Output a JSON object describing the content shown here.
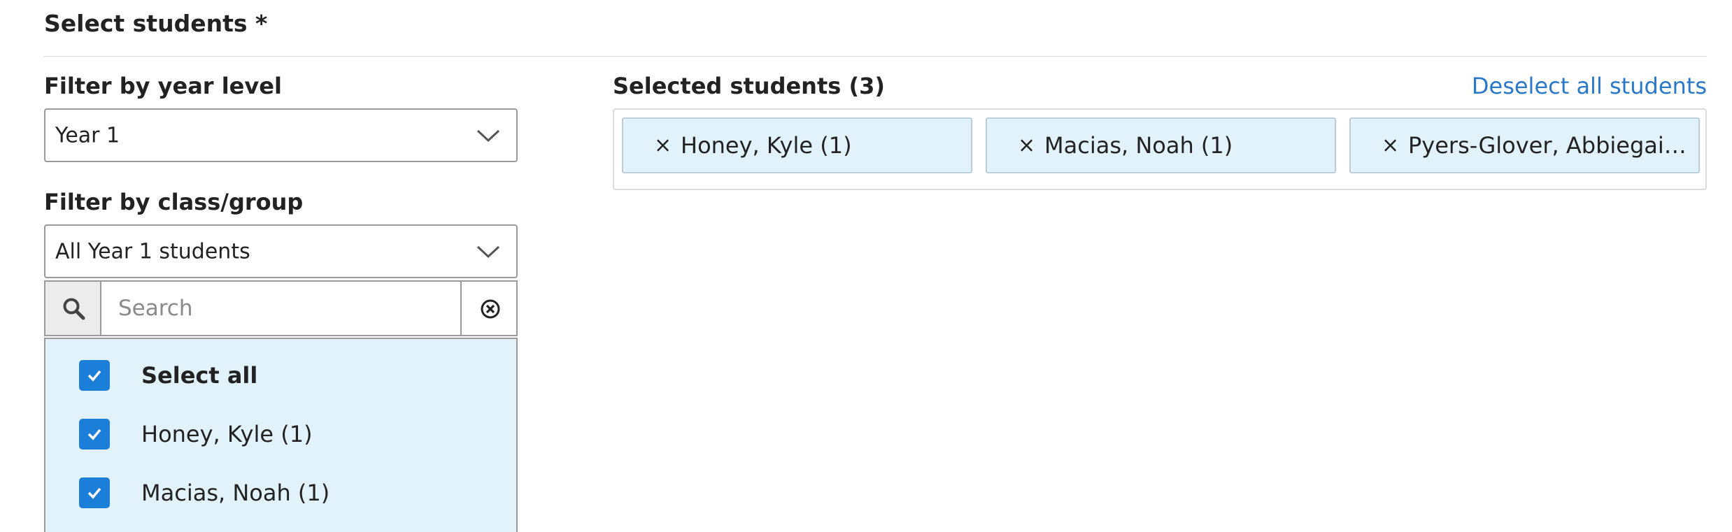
{
  "section": {
    "title": "Select students *"
  },
  "year_filter": {
    "label": "Filter by year level",
    "value": "Year 1"
  },
  "class_filter": {
    "label": "Filter by class/group",
    "value": "All Year 1 students"
  },
  "search": {
    "placeholder": "Search",
    "value": ""
  },
  "student_list": {
    "items": [
      {
        "label": "Select all",
        "checked": true
      },
      {
        "label": "Honey, Kyle (1)",
        "checked": true
      },
      {
        "label": "Macias, Noah (1)",
        "checked": true
      }
    ]
  },
  "selected": {
    "label": "Selected students (3)",
    "deselect_all": "Deselect all students",
    "remove_symbol": "×",
    "chips": [
      {
        "label": "Honey, Kyle (1)"
      },
      {
        "label": "Macias, Noah (1)"
      },
      {
        "label": "Pyers-Glover, Abbiegail..."
      }
    ]
  },
  "colors": {
    "accent": "#1b7fd9",
    "link": "#2a78c8",
    "chip_bg": "#e2f2fb"
  }
}
